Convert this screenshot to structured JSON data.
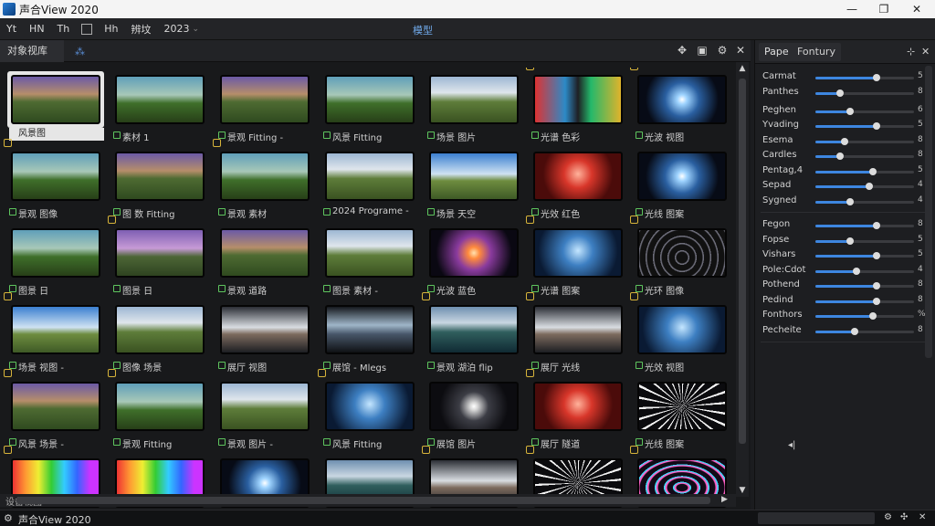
{
  "window": {
    "title": "声合View 2020"
  },
  "menubar": {
    "items": [
      "Yt",
      "HN",
      "Th",
      "Hh",
      "辨坟",
      "2023"
    ],
    "center_label": "模型"
  },
  "left_panel": {
    "tab_label": "对象视库",
    "tab_icon": "chart-icon"
  },
  "grid": {
    "rows": [
      [
        {
          "label": "风景图",
          "style": "t-field",
          "selected": true
        },
        {
          "label": "素材 1",
          "style": "t-field2"
        },
        {
          "label": "景观 Fitting -",
          "style": "t-field"
        },
        {
          "label": "风景 Fitting",
          "style": "t-field2"
        },
        {
          "label": "场景 图片",
          "style": "t-field3"
        },
        {
          "label": "光谱 色彩",
          "style": "t-neon",
          "badge": true
        },
        {
          "label": "光波 视图",
          "style": "t-burst",
          "badge": true
        }
      ],
      [
        {
          "label": "景观 图像",
          "style": "t-field2",
          "badge": true
        },
        {
          "label": "图 数 Fitting",
          "style": "t-field"
        },
        {
          "label": "景观 素材",
          "style": "t-field2",
          "badge": true
        },
        {
          "label": "2024 Programe -",
          "style": "t-field3"
        },
        {
          "label": "场景 天空",
          "style": "t-sky"
        },
        {
          "label": "光效 红色",
          "style": "t-red"
        },
        {
          "label": "光线 图案",
          "style": "t-burst"
        }
      ],
      [
        {
          "label": "图景 日",
          "style": "t-field2"
        },
        {
          "label": "图景 日",
          "style": "t-purple",
          "badge": true
        },
        {
          "label": "景观 道路",
          "style": "t-field"
        },
        {
          "label": "图景 素材 -",
          "style": "t-field3"
        },
        {
          "label": "光波 蓝色",
          "style": "t-burst2"
        },
        {
          "label": "光谱 图案",
          "style": "t-blue",
          "badge": true
        },
        {
          "label": "光环 图像",
          "style": "t-rings",
          "badge": true
        }
      ],
      [
        {
          "label": "场景 视图 -",
          "style": "t-sky",
          "badge": true
        },
        {
          "label": "图像 场景",
          "style": "t-field3"
        },
        {
          "label": "展厅 视图",
          "style": "t-hall"
        },
        {
          "label": "展馆 - Mlegs",
          "style": "t-hall2"
        },
        {
          "label": "景观 湖泊 flip",
          "style": "t-water",
          "badge": true
        },
        {
          "label": "展厅 光线",
          "style": "t-hall",
          "badge": true
        },
        {
          "label": "光效 视图",
          "style": "t-blue",
          "badge": true
        }
      ],
      [
        {
          "label": "风景 场景 -",
          "style": "t-field",
          "badge": true
        },
        {
          "label": "景观 Fitting",
          "style": "t-field2",
          "badge": true
        },
        {
          "label": "景观 图片 -",
          "style": "t-field3"
        },
        {
          "label": "风景 Fitting",
          "style": "t-blue",
          "badge": true
        },
        {
          "label": "展馆 图片",
          "style": "t-tunnel"
        },
        {
          "label": "展厅 隧道",
          "style": "t-red",
          "badge": true
        },
        {
          "label": "光线 图案",
          "style": "t-burst3"
        }
      ],
      [
        {
          "label": "",
          "style": "t-rainbow",
          "badge": true
        },
        {
          "label": "",
          "style": "t-rainbow"
        },
        {
          "label": "",
          "style": "t-burst"
        },
        {
          "label": "",
          "style": "t-water"
        },
        {
          "label": "",
          "style": "t-hall",
          "badge": true
        },
        {
          "label": "",
          "style": "t-burst3",
          "badge": true
        },
        {
          "label": "",
          "style": "t-rings2",
          "badge": true
        }
      ]
    ]
  },
  "hscroll": {
    "label": "设备视图"
  },
  "right_panel": {
    "tabs": [
      "Pape",
      "Fontury"
    ],
    "group1": [
      {
        "label": "Carmat",
        "value": 0.62,
        "readout": "5"
      },
      {
        "label": "Panthes",
        "value": 0.25,
        "readout": "8"
      },
      {
        "label": "Peghen",
        "value": 0.35,
        "readout": "6"
      },
      {
        "label": "Yvading",
        "value": 0.62,
        "readout": "5"
      },
      {
        "label": "Esema",
        "value": 0.3,
        "readout": "8"
      },
      {
        "label": "Cardles",
        "value": 0.25,
        "readout": "8"
      },
      {
        "label": "Pentag,4",
        "value": 0.58,
        "readout": "5"
      },
      {
        "label": "Sepad",
        "value": 0.55,
        "readout": "4"
      },
      {
        "label": "Sygned",
        "value": 0.35,
        "readout": "4"
      }
    ],
    "group2": [
      {
        "label": "Fegon",
        "value": 0.62,
        "readout": "8"
      },
      {
        "label": "Fopse",
        "value": 0.35,
        "readout": "5"
      },
      {
        "label": "Vishars",
        "value": 0.62,
        "readout": "5"
      },
      {
        "label": "Pole:Cdot",
        "value": 0.42,
        "readout": "4"
      },
      {
        "label": "Pothend",
        "value": 0.62,
        "readout": "8"
      },
      {
        "label": "Pedind",
        "value": 0.62,
        "readout": "8"
      },
      {
        "label": "Fonthors",
        "value": 0.58,
        "readout": "%"
      },
      {
        "label": "Pecheite",
        "value": 0.4,
        "readout": "8"
      }
    ]
  },
  "statusbar": {
    "text": "声合View 2020"
  },
  "colors": {
    "accent": "#3d86e0",
    "badge": "#d7b43b",
    "label_icon": "#5ec55e"
  }
}
